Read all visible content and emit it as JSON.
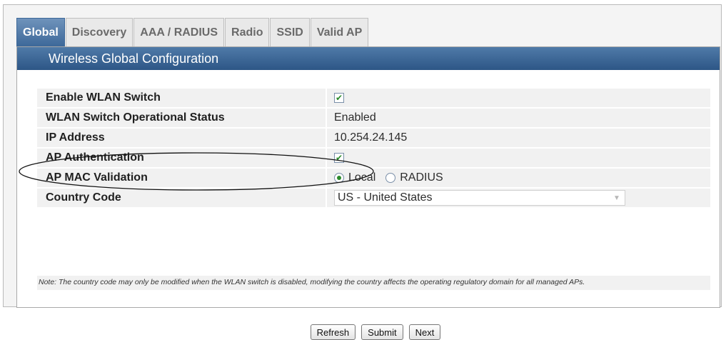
{
  "tabs": [
    {
      "label": "Global",
      "active": true
    },
    {
      "label": "Discovery",
      "active": false
    },
    {
      "label": "AAA / RADIUS",
      "active": false
    },
    {
      "label": "Radio",
      "active": false
    },
    {
      "label": "SSID",
      "active": false
    },
    {
      "label": "Valid AP",
      "active": false
    }
  ],
  "panel": {
    "title": "Wireless Global Configuration"
  },
  "fields": {
    "enable_wlan_switch": {
      "label": "Enable WLAN Switch",
      "checked": true
    },
    "wlan_status": {
      "label": "WLAN Switch Operational Status",
      "value": "Enabled"
    },
    "ip_address": {
      "label": "IP Address",
      "value": "10.254.24.145"
    },
    "ap_authentication": {
      "label": "AP Authentication",
      "checked": true
    },
    "ap_mac_validation": {
      "label": "AP MAC Validation",
      "options": [
        "Local",
        "RADIUS"
      ],
      "selected": "Local"
    },
    "country_code": {
      "label": "Country Code",
      "value": "US - United States"
    }
  },
  "note": "Note: The country code may only be modified when the WLAN switch is disabled, modifying the country affects the operating regulatory domain for all managed APs.",
  "buttons": {
    "refresh": "Refresh",
    "submit": "Submit",
    "next": "Next"
  },
  "colors": {
    "tab_active": "#3d6899",
    "panel_header": "#2d5686",
    "check": "#2a8a2a"
  }
}
